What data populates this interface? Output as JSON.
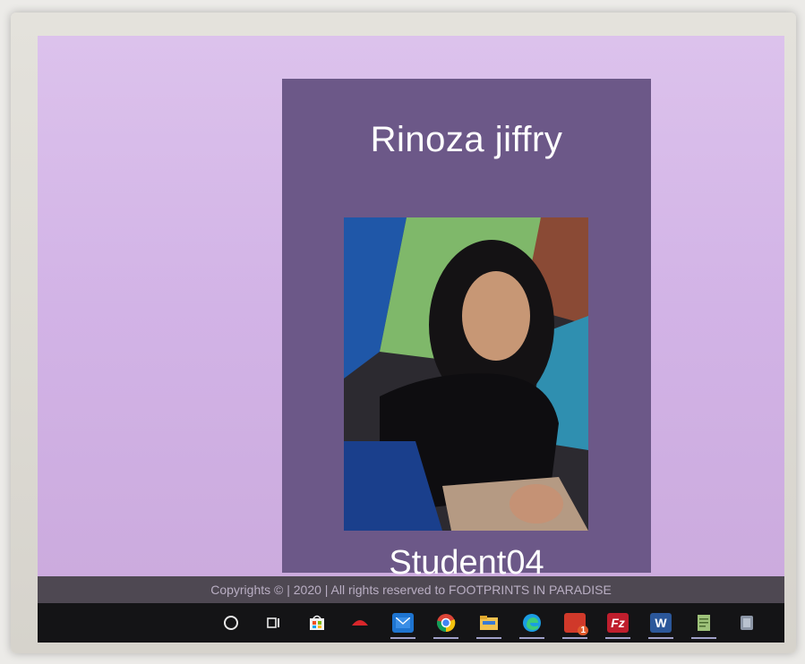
{
  "profile": {
    "name": "Rinoza jiffry",
    "student_id": "Student04"
  },
  "footer": {
    "copyright": "Copyrights © | 2020 | All rights reserved to FOOTPRINTS IN PARADISE"
  },
  "taskbar": {
    "items": [
      {
        "icon": "cortana-search-icon"
      },
      {
        "icon": "task-view-icon"
      },
      {
        "icon": "store-icon"
      },
      {
        "icon": "app-red-icon"
      },
      {
        "icon": "mail-icon"
      },
      {
        "icon": "chrome-icon"
      },
      {
        "icon": "file-explorer-icon"
      },
      {
        "icon": "edge-icon"
      },
      {
        "icon": "app-badge-icon",
        "badge": "1"
      },
      {
        "icon": "filezilla-icon",
        "label": "Fz"
      },
      {
        "icon": "word-icon",
        "label": "W"
      },
      {
        "icon": "notepad-icon"
      },
      {
        "icon": "app-grey-icon"
      }
    ]
  },
  "colors": {
    "screen_background": "#d6b9e8",
    "card_background": "#6c5888",
    "footer_background": "#4e4852",
    "taskbar_background": "#141416"
  }
}
